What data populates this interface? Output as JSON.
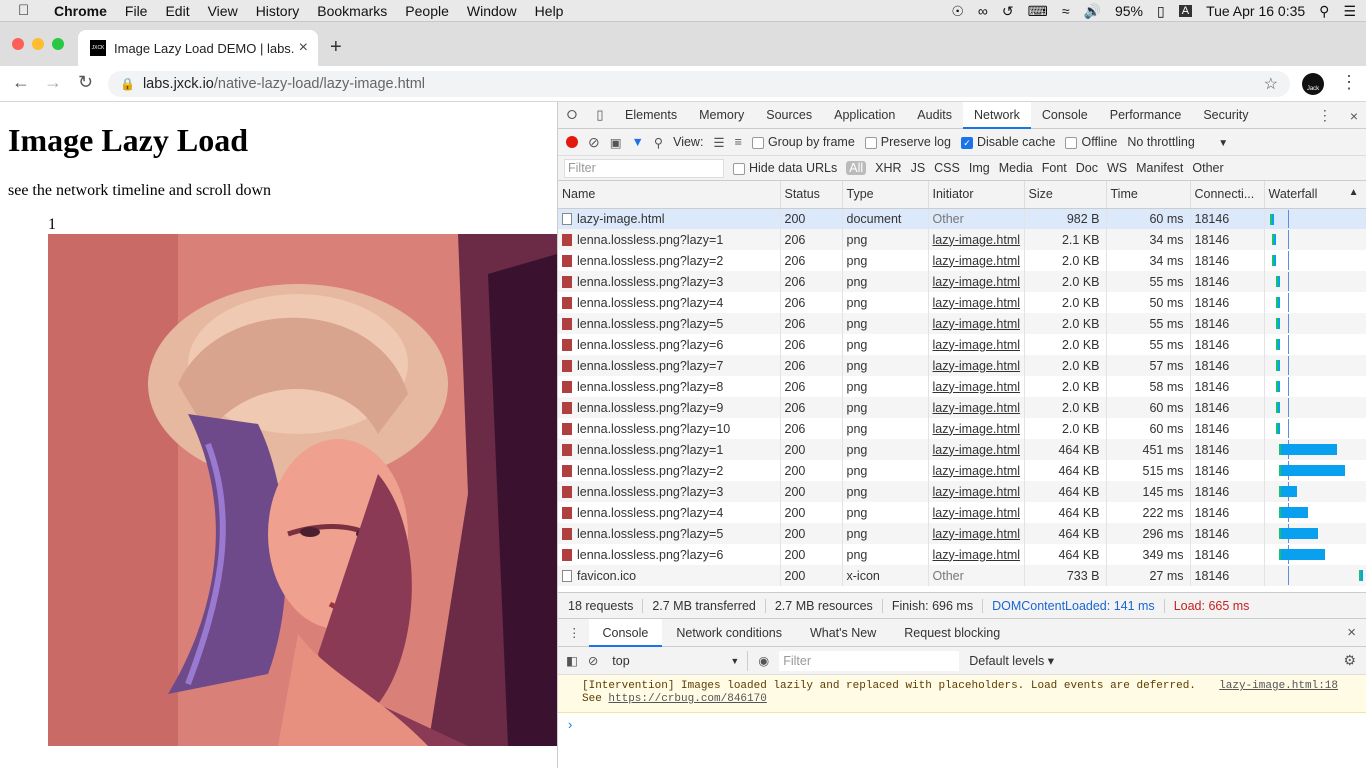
{
  "menubar": {
    "app": "Chrome",
    "items": [
      "File",
      "Edit",
      "View",
      "History",
      "Bookmarks",
      "People",
      "Window",
      "Help"
    ],
    "battery": "95%",
    "input_badge": "A",
    "clock": "Tue Apr 16  0:35"
  },
  "browser": {
    "tab_title": "Image Lazy Load DEMO | labs.",
    "favicon_text": "JXCK",
    "url_host": "labs.jxck.io",
    "url_path": "/native-lazy-load/lazy-image.html",
    "avatar_text": "Jack"
  },
  "page": {
    "title": "Image Lazy Load",
    "description": "see the network timeline and scroll down",
    "image_number": "1"
  },
  "devtools": {
    "tabs": [
      "Elements",
      "Memory",
      "Sources",
      "Application",
      "Audits",
      "Network",
      "Console",
      "Performance",
      "Security"
    ],
    "active_tab": "Network",
    "toolbar": {
      "view_label": "View:",
      "group_by_frame": "Group by frame",
      "preserve_log": "Preserve log",
      "disable_cache": "Disable cache",
      "offline": "Offline",
      "throttling": "No throttling"
    },
    "filter": {
      "placeholder": "Filter",
      "hide_data_urls": "Hide data URLs",
      "types": [
        "All",
        "XHR",
        "JS",
        "CSS",
        "Img",
        "Media",
        "Font",
        "Doc",
        "WS",
        "Manifest",
        "Other"
      ]
    },
    "columns": [
      "Name",
      "Status",
      "Type",
      "Initiator",
      "Size",
      "Time",
      "Connecti...",
      "Waterfall"
    ],
    "rows": [
      {
        "name": "lazy-image.html",
        "status": "200",
        "type": "document",
        "initiator": "Other",
        "size": "982 B",
        "time": "60 ms",
        "conn": "18146",
        "icon": "doc",
        "selected": true,
        "wf_start": 0.05,
        "wf_wait": 0.02,
        "wf_recv": 0.01
      },
      {
        "name": "lenna.lossless.png?lazy=1",
        "status": "206",
        "type": "png",
        "initiator": "lazy-image.html",
        "size": "2.1 KB",
        "time": "34 ms",
        "conn": "18146",
        "icon": "png",
        "wf_start": 0.07,
        "wf_wait": 0.02,
        "wf_recv": 0.01
      },
      {
        "name": "lenna.lossless.png?lazy=2",
        "status": "206",
        "type": "png",
        "initiator": "lazy-image.html",
        "size": "2.0 KB",
        "time": "34 ms",
        "conn": "18146",
        "icon": "png",
        "wf_start": 0.07,
        "wf_wait": 0.02,
        "wf_recv": 0.01
      },
      {
        "name": "lenna.lossless.png?lazy=3",
        "status": "206",
        "type": "png",
        "initiator": "lazy-image.html",
        "size": "2.0 KB",
        "time": "55 ms",
        "conn": "18146",
        "icon": "png",
        "wf_start": 0.11,
        "wf_wait": 0.02,
        "wf_recv": 0.01
      },
      {
        "name": "lenna.lossless.png?lazy=4",
        "status": "206",
        "type": "png",
        "initiator": "lazy-image.html",
        "size": "2.0 KB",
        "time": "50 ms",
        "conn": "18146",
        "icon": "png",
        "wf_start": 0.11,
        "wf_wait": 0.02,
        "wf_recv": 0.01
      },
      {
        "name": "lenna.lossless.png?lazy=5",
        "status": "206",
        "type": "png",
        "initiator": "lazy-image.html",
        "size": "2.0 KB",
        "time": "55 ms",
        "conn": "18146",
        "icon": "png",
        "wf_start": 0.11,
        "wf_wait": 0.02,
        "wf_recv": 0.01
      },
      {
        "name": "lenna.lossless.png?lazy=6",
        "status": "206",
        "type": "png",
        "initiator": "lazy-image.html",
        "size": "2.0 KB",
        "time": "55 ms",
        "conn": "18146",
        "icon": "png",
        "wf_start": 0.11,
        "wf_wait": 0.02,
        "wf_recv": 0.01
      },
      {
        "name": "lenna.lossless.png?lazy=7",
        "status": "206",
        "type": "png",
        "initiator": "lazy-image.html",
        "size": "2.0 KB",
        "time": "57 ms",
        "conn": "18146",
        "icon": "png",
        "wf_start": 0.11,
        "wf_wait": 0.02,
        "wf_recv": 0.01
      },
      {
        "name": "lenna.lossless.png?lazy=8",
        "status": "206",
        "type": "png",
        "initiator": "lazy-image.html",
        "size": "2.0 KB",
        "time": "58 ms",
        "conn": "18146",
        "icon": "png",
        "wf_start": 0.11,
        "wf_wait": 0.02,
        "wf_recv": 0.01
      },
      {
        "name": "lenna.lossless.png?lazy=9",
        "status": "206",
        "type": "png",
        "initiator": "lazy-image.html",
        "size": "2.0 KB",
        "time": "60 ms",
        "conn": "18146",
        "icon": "png",
        "wf_start": 0.11,
        "wf_wait": 0.02,
        "wf_recv": 0.01
      },
      {
        "name": "lenna.lossless.png?lazy=10",
        "status": "206",
        "type": "png",
        "initiator": "lazy-image.html",
        "size": "2.0 KB",
        "time": "60 ms",
        "conn": "18146",
        "icon": "png",
        "wf_start": 0.11,
        "wf_wait": 0.02,
        "wf_recv": 0.01
      },
      {
        "name": "lenna.lossless.png?lazy=1",
        "status": "200",
        "type": "png",
        "initiator": "lazy-image.html",
        "size": "464 KB",
        "time": "451 ms",
        "conn": "18146",
        "icon": "png",
        "wf_start": 0.14,
        "wf_wait": 0.03,
        "wf_recv": 0.58
      },
      {
        "name": "lenna.lossless.png?lazy=2",
        "status": "200",
        "type": "png",
        "initiator": "lazy-image.html",
        "size": "464 KB",
        "time": "515 ms",
        "conn": "18146",
        "icon": "png",
        "wf_start": 0.14,
        "wf_wait": 0.03,
        "wf_recv": 0.66
      },
      {
        "name": "lenna.lossless.png?lazy=3",
        "status": "200",
        "type": "png",
        "initiator": "lazy-image.html",
        "size": "464 KB",
        "time": "145 ms",
        "conn": "18146",
        "icon": "png",
        "wf_start": 0.14,
        "wf_wait": 0.03,
        "wf_recv": 0.17
      },
      {
        "name": "lenna.lossless.png?lazy=4",
        "status": "200",
        "type": "png",
        "initiator": "lazy-image.html",
        "size": "464 KB",
        "time": "222 ms",
        "conn": "18146",
        "icon": "png",
        "wf_start": 0.14,
        "wf_wait": 0.03,
        "wf_recv": 0.28
      },
      {
        "name": "lenna.lossless.png?lazy=5",
        "status": "200",
        "type": "png",
        "initiator": "lazy-image.html",
        "size": "464 KB",
        "time": "296 ms",
        "conn": "18146",
        "icon": "png",
        "wf_start": 0.14,
        "wf_wait": 0.03,
        "wf_recv": 0.38
      },
      {
        "name": "lenna.lossless.png?lazy=6",
        "status": "200",
        "type": "png",
        "initiator": "lazy-image.html",
        "size": "464 KB",
        "time": "349 ms",
        "conn": "18146",
        "icon": "png",
        "wf_start": 0.14,
        "wf_wait": 0.03,
        "wf_recv": 0.45
      },
      {
        "name": "favicon.ico",
        "status": "200",
        "type": "x-icon",
        "initiator": "Other",
        "size": "733 B",
        "time": "27 ms",
        "conn": "18146",
        "icon": "doc",
        "wf_start": 0.97,
        "wf_wait": 0.02,
        "wf_recv": 0.01
      }
    ],
    "summary": {
      "requests": "18 requests",
      "transferred": "2.7 MB transferred",
      "resources": "2.7 MB resources",
      "finish": "Finish: 696 ms",
      "domcontentloaded": "DOMContentLoaded: 141 ms",
      "load": "Load: 665 ms"
    },
    "drawer_tabs": [
      "Console",
      "Network conditions",
      "What's New",
      "Request blocking"
    ],
    "console": {
      "context": "top",
      "filter_placeholder": "Filter",
      "levels": "Default levels ▾",
      "message_line1": "[Intervention] Images loaded lazily and replaced with placeholders. Load events are deferred.",
      "message_see": "See ",
      "message_link": "https://crbug.com/846170",
      "message_source": "lazy-image.html:18",
      "prompt": "›"
    }
  },
  "colors": {
    "accent": "#1a73e8",
    "record": "#e5180e",
    "waterfall_receive": "#0aa0f0",
    "waterfall_wait": "#19c36b"
  }
}
